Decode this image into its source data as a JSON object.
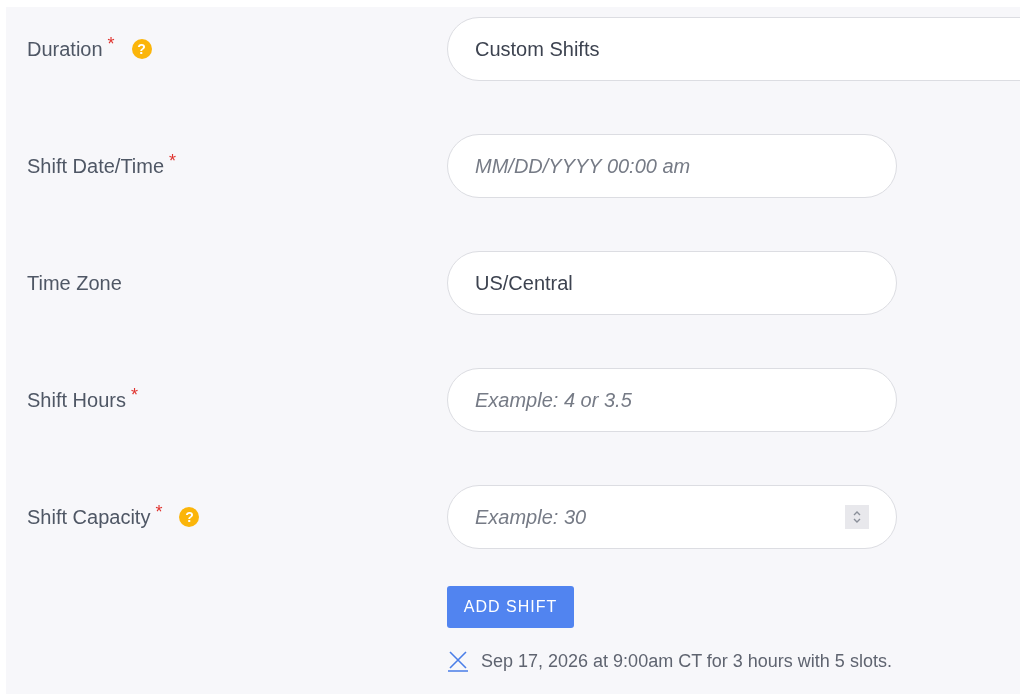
{
  "fields": [
    {
      "label": "Duration",
      "required_mark": "*",
      "help": "?",
      "kind": "select",
      "value": "Custom Shifts"
    },
    {
      "label": "Shift Date/Time",
      "required_mark": "*",
      "kind": "text",
      "placeholder": "MM/DD/YYYY 00:00 am"
    },
    {
      "label": "Time Zone",
      "kind": "text",
      "value": "US/Central"
    },
    {
      "label": "Shift Hours",
      "required_mark": "*",
      "kind": "text",
      "placeholder": "Example: 4 or 3.5"
    },
    {
      "label": "Shift Capacity",
      "required_mark": "*",
      "help": "?",
      "kind": "number",
      "placeholder": "Example: 30"
    }
  ],
  "add_button": "ADD SHIFT",
  "shifts": [
    {
      "text": "Sep 17, 2026 at 9:00am CT for 3 hours with 5 slots."
    }
  ]
}
